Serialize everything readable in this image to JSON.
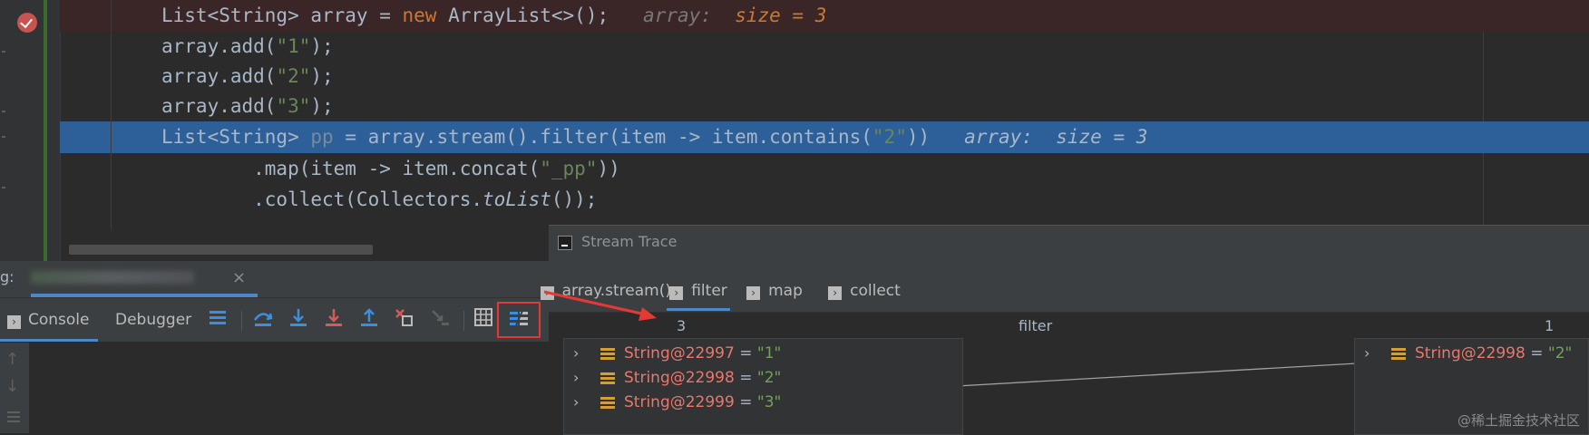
{
  "editor": {
    "lines": [
      {
        "parts": [
          [
            "",
            "List<String> array = "
          ],
          [
            "kw",
            "new"
          ],
          [
            "",
            " ArrayList<>();"
          ]
        ],
        "hint_name": "array:",
        "hint_val": "size = 3"
      },
      {
        "parts": [
          [
            "",
            "array.add("
          ],
          [
            "str",
            "\"1\""
          ],
          [
            "",
            ");"
          ]
        ]
      },
      {
        "parts": [
          [
            "",
            "array.add("
          ],
          [
            "str",
            "\"2\""
          ],
          [
            "",
            ");"
          ]
        ]
      },
      {
        "parts": [
          [
            "",
            "array.add("
          ],
          [
            "str",
            "\"3\""
          ],
          [
            "",
            ");"
          ]
        ]
      },
      {
        "parts": [
          [
            "",
            "List<String> "
          ],
          [
            "faded",
            "pp"
          ],
          [
            "",
            " = array.stream().filter(item -> item.contains("
          ],
          [
            "str",
            "\"2\""
          ],
          [
            "",
            "))"
          ]
        ],
        "hint_name": "array:",
        "hint_val": "size = 3"
      },
      {
        "parts": [
          [
            "",
            "        .map(item -> item.concat("
          ],
          [
            "str",
            "\"_pp\""
          ],
          [
            "",
            "))"
          ]
        ]
      },
      {
        "parts": [
          [
            "",
            "        .collect(Collectors."
          ],
          [
            "it",
            "toList"
          ],
          [
            "",
            "());"
          ]
        ]
      }
    ]
  },
  "debug": {
    "title_fragment": "g:",
    "session_close": "×",
    "tabs": {
      "console": "Console",
      "debugger": "Debugger"
    },
    "side_up": "↑",
    "side_down": "↓"
  },
  "trace": {
    "title": "Stream Trace",
    "tabs": [
      "array.stream()",
      "filter",
      "map",
      "collect"
    ],
    "active_tab": "filter",
    "col_left_count": "3",
    "col_mid_label": "filter",
    "col_right_count": "1",
    "left_items": [
      {
        "obj": "String@22997",
        "eq": " = ",
        "val": "\"1\""
      },
      {
        "obj": "String@22998",
        "eq": " = ",
        "val": "\"2\""
      },
      {
        "obj": "String@22999",
        "eq": " = ",
        "val": "\"3\""
      }
    ],
    "right_items": [
      {
        "obj": "String@22998",
        "eq": " = ",
        "val": "\"2\""
      }
    ]
  },
  "watermark": "@稀土掘金技术社区",
  "colors": {
    "accent": "#4a88c7",
    "highlight": "#2d5f99",
    "annotation": "#e53935"
  }
}
